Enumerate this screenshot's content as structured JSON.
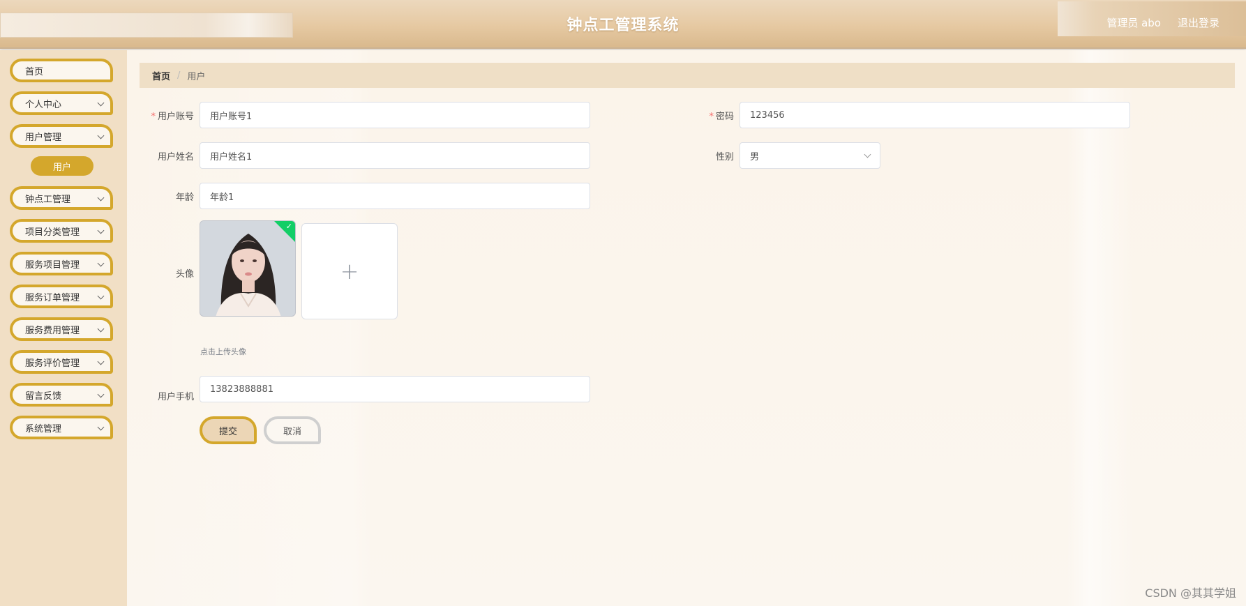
{
  "header": {
    "title": "钟点工管理系统",
    "user": "管理员 abo",
    "logout": "退出登录"
  },
  "sidebar": {
    "items": [
      {
        "label": "首页"
      },
      {
        "label": "个人中心"
      },
      {
        "label": "用户管理"
      },
      {
        "label": "钟点工管理"
      },
      {
        "label": "项目分类管理"
      },
      {
        "label": "服务项目管理"
      },
      {
        "label": "服务订单管理"
      },
      {
        "label": "服务费用管理"
      },
      {
        "label": "服务评价管理"
      },
      {
        "label": "留言反馈"
      },
      {
        "label": "系统管理"
      }
    ],
    "active_sub": "用户"
  },
  "breadcrumb": {
    "home": "首页",
    "sep": "/",
    "current": "用户"
  },
  "form": {
    "account_label": "用户账号",
    "account_value": "用户账号1",
    "password_label": "密码",
    "password_value": "123456",
    "name_label": "用户姓名",
    "name_value": "用户姓名1",
    "gender_label": "性别",
    "gender_value": "男",
    "age_label": "年龄",
    "age_value": "年龄1",
    "avatar_label": "头像",
    "upload_tip": "点击上传头像",
    "phone_label": "用户手机",
    "phone_value": "13823888881",
    "required_mark": "*",
    "submit": "提交",
    "cancel": "取消"
  },
  "watermark": "CSDN @其其学姐",
  "colors": {
    "accent": "#d4a72c",
    "sidebar_bg": "#f1dfc5",
    "required": "#f56c6c",
    "upload_success": "#13ce66"
  }
}
